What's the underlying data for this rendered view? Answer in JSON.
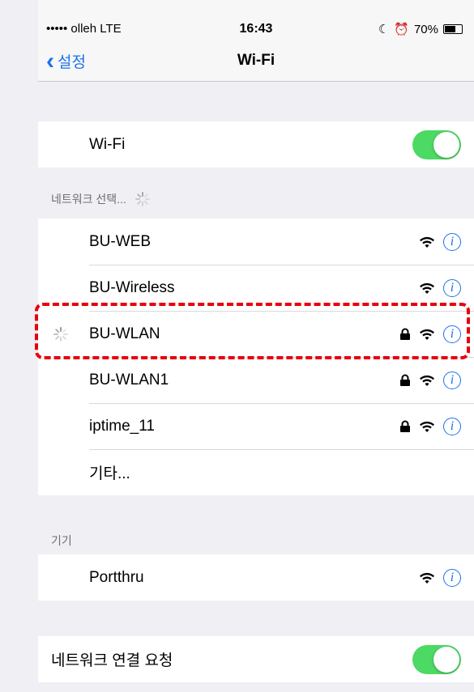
{
  "status_bar": {
    "carrier": "••••• olleh  LTE",
    "time": "16:43",
    "battery_text": "70%",
    "battery_level": 0.7
  },
  "nav": {
    "back_label": "설정",
    "title": "Wi-Fi"
  },
  "wifi_toggle": {
    "label": "Wi-Fi",
    "on": true
  },
  "networks_section": {
    "header": "네트워크 선택..."
  },
  "networks": [
    {
      "name": "BU-WEB",
      "locked": false
    },
    {
      "name": "BU-Wireless",
      "locked": false
    },
    {
      "name": "BU-WLAN",
      "locked": true,
      "connecting": true
    },
    {
      "name": "BU-WLAN1",
      "locked": true
    },
    {
      "name": "iptime_11",
      "locked": true
    }
  ],
  "other_label": "기타...",
  "devices_section": {
    "header": "기기",
    "items": [
      {
        "name": "Portthru"
      }
    ]
  },
  "ask_join": {
    "label": "네트워크 연결 요청",
    "on": true
  },
  "colors": {
    "accent": "#1a73e8",
    "toggle_on": "#4cd964",
    "highlight": "#e8000b"
  }
}
